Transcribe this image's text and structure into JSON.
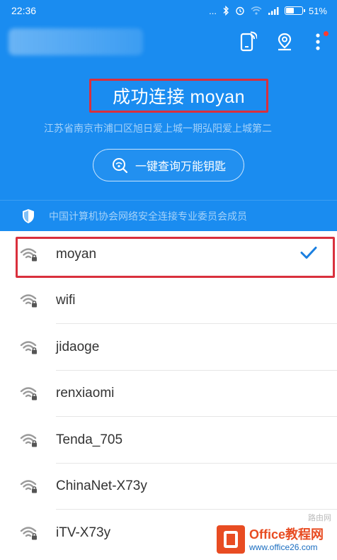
{
  "status_bar": {
    "time": "22:36",
    "dots": "...",
    "battery": "51%",
    "battery_level": 0.51
  },
  "header": {
    "title": "成功连接 moyan",
    "location": "江苏省南京市浦口区旭日爱上城一期弘阳爱上城第二",
    "key_button_label": "一键查询万能钥匙",
    "member_text": "中国计算机协会网络安全连接专业委员会成员",
    "icons": [
      "phone-wifi-icon",
      "location-pin-icon",
      "more-vertical-icon"
    ]
  },
  "wifi_list": [
    {
      "ssid": "moyan",
      "connected": true
    },
    {
      "ssid": "wifi",
      "connected": false
    },
    {
      "ssid": "jidaoge",
      "connected": false
    },
    {
      "ssid": "renxiaomi",
      "connected": false
    },
    {
      "ssid": "Tenda_705",
      "connected": false
    },
    {
      "ssid": "ChinaNet-X73y",
      "connected": false
    },
    {
      "ssid": "iTV-X73y",
      "connected": false
    }
  ],
  "watermark": {
    "title": "Office教程网",
    "url": "www.office26.com",
    "corner": "路由网"
  },
  "colors": {
    "primary": "#1a8cf0",
    "highlight_red": "#d9303d",
    "check_blue": "#1a7fe0",
    "watermark_orange": "#e84c22"
  }
}
